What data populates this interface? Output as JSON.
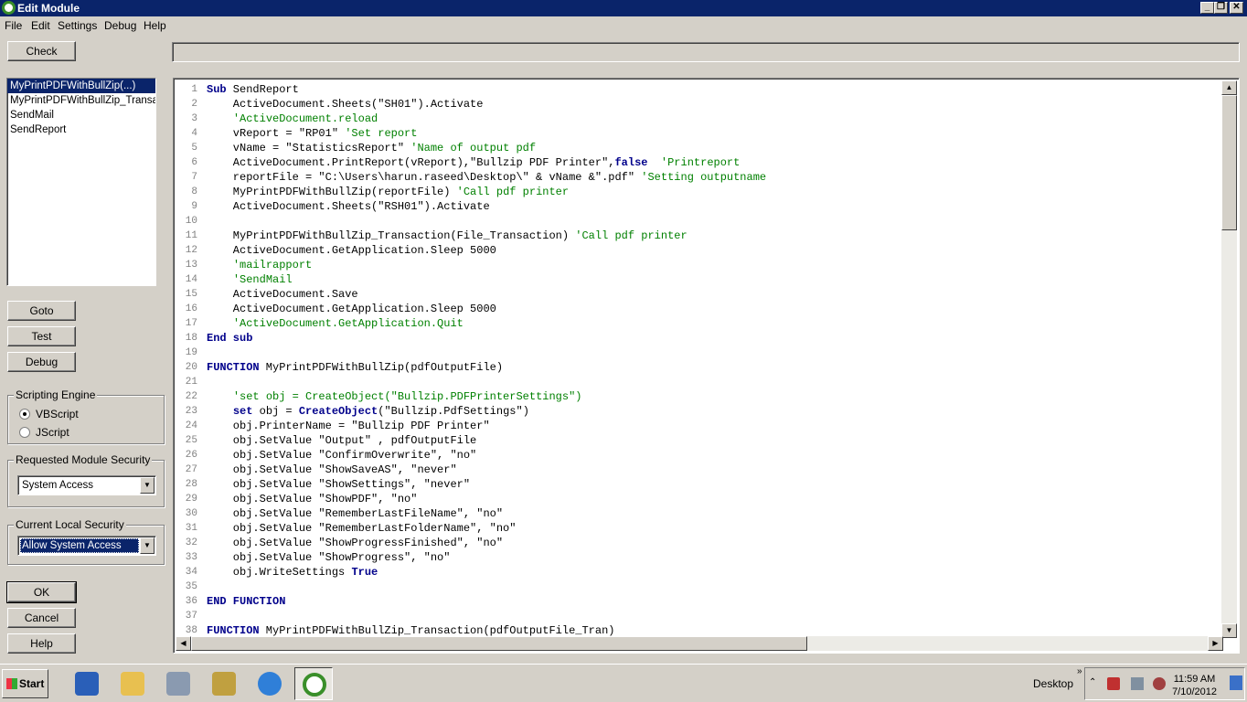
{
  "window": {
    "title": "Edit Module"
  },
  "menu": [
    "File",
    "Edit",
    "Settings",
    "Debug",
    "Help"
  ],
  "buttons": {
    "check": "Check",
    "goto": "Goto",
    "test": "Test",
    "debug": "Debug",
    "ok": "OK",
    "cancel": "Cancel",
    "help": "Help"
  },
  "modules": [
    {
      "name": "MyPrintPDFWithBullZip(...)",
      "selected": true
    },
    {
      "name": "MyPrintPDFWithBullZip_Transaction(...)",
      "selected": false
    },
    {
      "name": "SendMail",
      "selected": false
    },
    {
      "name": "SendReport",
      "selected": false
    }
  ],
  "scripting_engine": {
    "label": "Scripting Engine",
    "options": [
      "VBScript",
      "JScript"
    ],
    "selected": "VBScript"
  },
  "requested_security": {
    "label": "Requested Module Security",
    "value": "System Access"
  },
  "local_security": {
    "label": "Current Local Security",
    "value": "Allow System Access"
  },
  "code_lines": [
    [
      [
        "kw",
        "Sub"
      ],
      [
        "t",
        " SendReport"
      ]
    ],
    [
      [
        "t",
        "    ActiveDocument.Sheets(\"SH01\").Activate"
      ]
    ],
    [
      [
        "t",
        "    "
      ],
      [
        "cm",
        "'ActiveDocument.reload"
      ]
    ],
    [
      [
        "t",
        "    vReport = \"RP01\" "
      ],
      [
        "cm",
        "'Set report"
      ]
    ],
    [
      [
        "t",
        "    vName = \"StatisticsReport\" "
      ],
      [
        "cm",
        "'Name of output pdf"
      ]
    ],
    [
      [
        "t",
        "    ActiveDocument.PrintReport(vReport),\"Bullzip PDF Printer\","
      ],
      [
        "kw",
        "false"
      ],
      [
        "t",
        "  "
      ],
      [
        "cm",
        "'Printreport"
      ]
    ],
    [
      [
        "t",
        "    reportFile = \"C:\\Users\\harun.raseed\\Desktop\\\" & vName &\".pdf\" "
      ],
      [
        "cm",
        "'Setting outputname"
      ]
    ],
    [
      [
        "t",
        "    MyPrintPDFWithBullZip(reportFile) "
      ],
      [
        "cm",
        "'Call pdf printer"
      ]
    ],
    [
      [
        "t",
        "    ActiveDocument.Sheets(\"RSH01\").Activate"
      ]
    ],
    [
      [
        "t",
        ""
      ]
    ],
    [
      [
        "t",
        "    MyPrintPDFWithBullZip_Transaction(File_Transaction) "
      ],
      [
        "cm",
        "'Call pdf printer"
      ]
    ],
    [
      [
        "t",
        "    ActiveDocument.GetApplication.Sleep 5000"
      ]
    ],
    [
      [
        "t",
        "    "
      ],
      [
        "cm",
        "'mailrapport"
      ]
    ],
    [
      [
        "t",
        "    "
      ],
      [
        "cm",
        "'SendMail"
      ]
    ],
    [
      [
        "t",
        "    ActiveDocument.Save"
      ]
    ],
    [
      [
        "t",
        "    ActiveDocument.GetApplication.Sleep 5000"
      ]
    ],
    [
      [
        "t",
        "    "
      ],
      [
        "cm",
        "'ActiveDocument.GetApplication.Quit"
      ]
    ],
    [
      [
        "kw",
        "End sub"
      ]
    ],
    [
      [
        "t",
        ""
      ]
    ],
    [
      [
        "kw",
        "FUNCTION"
      ],
      [
        "t",
        " MyPrintPDFWithBullZip(pdfOutputFile)"
      ]
    ],
    [
      [
        "t",
        ""
      ]
    ],
    [
      [
        "t",
        "    "
      ],
      [
        "cm",
        "'set obj = CreateObject(\"Bullzip.PDFPrinterSettings\")"
      ]
    ],
    [
      [
        "t",
        "    "
      ],
      [
        "kw",
        "set"
      ],
      [
        "t",
        " obj = "
      ],
      [
        "kw",
        "CreateObject"
      ],
      [
        "t",
        "(\"Bullzip.PdfSettings\")"
      ]
    ],
    [
      [
        "t",
        "    obj.PrinterName = \"Bullzip PDF Printer\""
      ]
    ],
    [
      [
        "t",
        "    obj.SetValue \"Output\" , pdfOutputFile"
      ]
    ],
    [
      [
        "t",
        "    obj.SetValue \"ConfirmOverwrite\", \"no\""
      ]
    ],
    [
      [
        "t",
        "    obj.SetValue \"ShowSaveAS\", \"never\""
      ]
    ],
    [
      [
        "t",
        "    obj.SetValue \"ShowSettings\", \"never\""
      ]
    ],
    [
      [
        "t",
        "    obj.SetValue \"ShowPDF\", \"no\""
      ]
    ],
    [
      [
        "t",
        "    obj.SetValue \"RememberLastFileName\", \"no\""
      ]
    ],
    [
      [
        "t",
        "    obj.SetValue \"RememberLastFolderName\", \"no\""
      ]
    ],
    [
      [
        "t",
        "    obj.SetValue \"ShowProgressFinished\", \"no\""
      ]
    ],
    [
      [
        "t",
        "    obj.SetValue \"ShowProgress\", \"no\""
      ]
    ],
    [
      [
        "t",
        "    obj.WriteSettings "
      ],
      [
        "kw",
        "True"
      ]
    ],
    [
      [
        "t",
        ""
      ]
    ],
    [
      [
        "kw",
        "END FUNCTION"
      ]
    ],
    [
      [
        "t",
        ""
      ]
    ],
    [
      [
        "kw",
        "FUNCTION"
      ],
      [
        "t",
        " MyPrintPDFWithBullZip_Transaction(pdfOutputFile_Tran)"
      ]
    ]
  ],
  "taskbar": {
    "start_label": "Start",
    "desktop_label": "Desktop",
    "time": "11:59 AM",
    "date": "7/10/2012",
    "apps": [
      {
        "icon": "powershell-icon",
        "color": "#2a5fb8"
      },
      {
        "icon": "folder-icon",
        "color": "#e8c050"
      },
      {
        "icon": "server-manager-icon",
        "color": "#8a9ab0"
      },
      {
        "icon": "tools-icon",
        "color": "#c0a040"
      },
      {
        "icon": "internet-explorer-icon",
        "color": "#2f7fd8"
      },
      {
        "icon": "qlikview-icon",
        "color": "#3a8f2a"
      }
    ]
  }
}
